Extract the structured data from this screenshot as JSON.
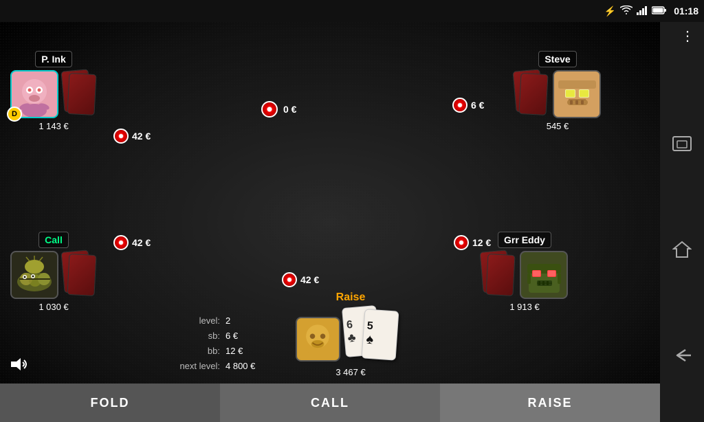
{
  "statusBar": {
    "time": "01:18",
    "bluetoothIcon": "🔵",
    "wifiIcon": "📶",
    "signalIcon": "📶",
    "batteryIcon": "🔋"
  },
  "players": {
    "pink": {
      "name": "P. Ink",
      "chips": "1 143 €",
      "bet": "42 €",
      "isDealer": true,
      "avatar": "🐣"
    },
    "steve": {
      "name": "Steve",
      "chips": "545 €",
      "bet": "6 €",
      "isDealer": false,
      "avatar": "🤖"
    },
    "call": {
      "name": "Call",
      "chips": "1 030 €",
      "bet": "42 €",
      "statusLabel": "Call",
      "isDealer": false,
      "avatar": "🐛"
    },
    "geddy": {
      "name": "Grr Eddy",
      "chips": "1 913 €",
      "bet": "12 €",
      "isDealer": false,
      "avatar": "🤖"
    },
    "human": {
      "chips": "3 467 €",
      "bet": "42 €",
      "statusLabel": "Raise",
      "card1": "6",
      "card1suit": "♣",
      "card2": "5",
      "card2suit": "♠",
      "avatar": "🥚"
    }
  },
  "pot": {
    "amount": "0 €"
  },
  "gameInfo": {
    "levelLabel": "level:",
    "levelValue": "2",
    "sbLabel": "sb:",
    "sbValue": "6 €",
    "bbLabel": "bb:",
    "bbValue": "12 €",
    "nextLevelLabel": "next level:",
    "nextLevelValue": "4 800 €"
  },
  "actions": {
    "fold": "FOLD",
    "call": "CALL",
    "raise": "RAISE"
  },
  "sidebar": {
    "icons": [
      "window",
      "home",
      "back"
    ]
  }
}
